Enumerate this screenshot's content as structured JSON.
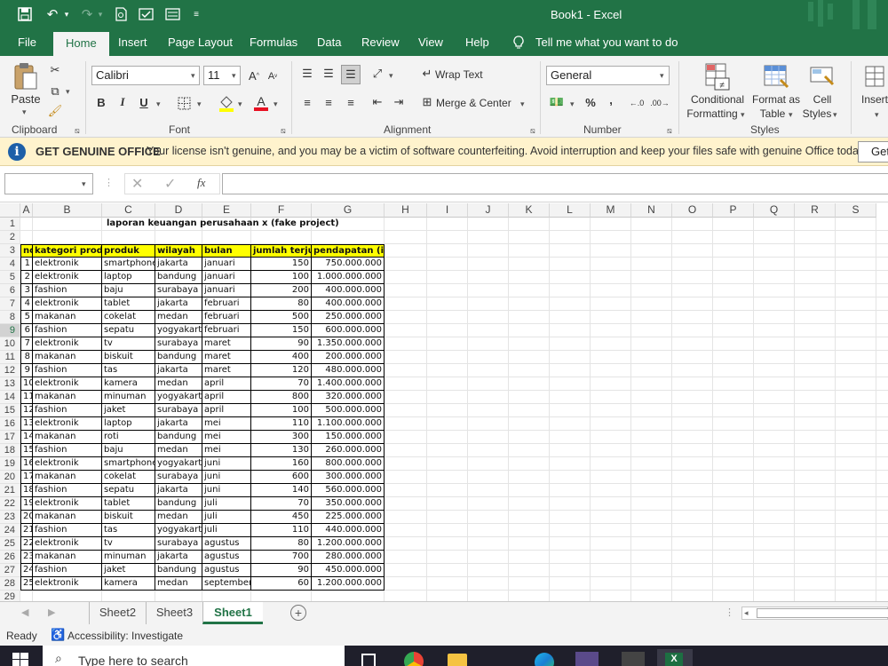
{
  "title_bar": {
    "title": "Book1  -  Excel"
  },
  "tabs": [
    "File",
    "Home",
    "Insert",
    "Page Layout",
    "Formulas",
    "Data",
    "Review",
    "View",
    "Help"
  ],
  "tell_me": "Tell me what you want to do",
  "ribbon": {
    "paste": "Paste",
    "clipboard": "Clipboard",
    "font_name": "Calibri",
    "font_size": "11",
    "font": "Font",
    "bold": "B",
    "italic": "I",
    "underline": "U",
    "wrap_text": "Wrap Text",
    "merge_center": "Merge & Center",
    "alignment": "Alignment",
    "number_format": "General",
    "number": "Number",
    "percent": "%",
    "comma": ",",
    "conditional_formatting_1": "Conditional",
    "conditional_formatting_2": "Formatting",
    "format_as_table_1": "Format as",
    "format_as_table_2": "Table",
    "cell_styles_1": "Cell",
    "cell_styles_2": "Styles",
    "styles": "Styles",
    "insert": "Insert"
  },
  "message_bar": {
    "heading": "GET GENUINE OFFICE",
    "text": "Your license isn't genuine, and you may be a victim of software counterfeiting. Avoid interruption and keep your files safe with genuine Office today.",
    "button": "Get"
  },
  "formula_bar": {
    "name_box": "",
    "fx": "fx",
    "formula": ""
  },
  "columns": [
    "A",
    "B",
    "C",
    "D",
    "E",
    "F",
    "G",
    "H",
    "I",
    "J",
    "K",
    "L",
    "M",
    "N",
    "O",
    "P",
    "Q",
    "R",
    "S"
  ],
  "rows": [
    "1",
    "2",
    "3",
    "4",
    "5",
    "6",
    "7",
    "8",
    "9",
    "10",
    "11",
    "12",
    "13",
    "14",
    "15",
    "16",
    "17",
    "18",
    "19",
    "20",
    "21",
    "22",
    "23",
    "24",
    "25",
    "26",
    "27",
    "28",
    "29"
  ],
  "sheet": {
    "title": "laporan keuangan perusahaan x (fake project)",
    "headers": [
      "no",
      "kategori produk",
      "produk",
      "wilayah",
      "bulan",
      "jumlah terjual",
      "pendapatan (idr)"
    ],
    "data": [
      [
        "1",
        "elektronik",
        "smartphone",
        "jakarta",
        "januari",
        "150",
        "750.000.000"
      ],
      [
        "2",
        "elektronik",
        "laptop",
        "bandung",
        "januari",
        "100",
        "1.000.000.000"
      ],
      [
        "3",
        "fashion",
        "baju",
        "surabaya",
        "januari",
        "200",
        "400.000.000"
      ],
      [
        "4",
        "elektronik",
        "tablet",
        "jakarta",
        "februari",
        "80",
        "400.000.000"
      ],
      [
        "5",
        "makanan",
        "cokelat",
        "medan",
        "februari",
        "500",
        "250.000.000"
      ],
      [
        "6",
        "fashion",
        "sepatu",
        "yogyakarta",
        "februari",
        "150",
        "600.000.000"
      ],
      [
        "7",
        "elektronik",
        "tv",
        "surabaya",
        "maret",
        "90",
        "1.350.000.000"
      ],
      [
        "8",
        "makanan",
        "biskuit",
        "bandung",
        "maret",
        "400",
        "200.000.000"
      ],
      [
        "9",
        "fashion",
        "tas",
        "jakarta",
        "maret",
        "120",
        "480.000.000"
      ],
      [
        "10",
        "elektronik",
        "kamera",
        "medan",
        "april",
        "70",
        "1.400.000.000"
      ],
      [
        "11",
        "makanan",
        "minuman",
        "yogyakarta",
        "april",
        "800",
        "320.000.000"
      ],
      [
        "12",
        "fashion",
        "jaket",
        "surabaya",
        "april",
        "100",
        "500.000.000"
      ],
      [
        "13",
        "elektronik",
        "laptop",
        "jakarta",
        "mei",
        "110",
        "1.100.000.000"
      ],
      [
        "14",
        "makanan",
        "roti",
        "bandung",
        "mei",
        "300",
        "150.000.000"
      ],
      [
        "15",
        "fashion",
        "baju",
        "medan",
        "mei",
        "130",
        "260.000.000"
      ],
      [
        "16",
        "elektronik",
        "smartphone",
        "yogyakarta",
        "juni",
        "160",
        "800.000.000"
      ],
      [
        "17",
        "makanan",
        "cokelat",
        "surabaya",
        "juni",
        "600",
        "300.000.000"
      ],
      [
        "18",
        "fashion",
        "sepatu",
        "jakarta",
        "juni",
        "140",
        "560.000.000"
      ],
      [
        "19",
        "elektronik",
        "tablet",
        "bandung",
        "juli",
        "70",
        "350.000.000"
      ],
      [
        "20",
        "makanan",
        "biskuit",
        "medan",
        "juli",
        "450",
        "225.000.000"
      ],
      [
        "21",
        "fashion",
        "tas",
        "yogyakarta",
        "juli",
        "110",
        "440.000.000"
      ],
      [
        "22",
        "elektronik",
        "tv",
        "surabaya",
        "agustus",
        "80",
        "1.200.000.000"
      ],
      [
        "23",
        "makanan",
        "minuman",
        "jakarta",
        "agustus",
        "700",
        "280.000.000"
      ],
      [
        "24",
        "fashion",
        "jaket",
        "bandung",
        "agustus",
        "90",
        "450.000.000"
      ],
      [
        "25",
        "elektronik",
        "kamera",
        "medan",
        "september",
        "60",
        "1.200.000.000"
      ]
    ]
  },
  "sheet_tabs": [
    "Sheet2",
    "Sheet3",
    "Sheet1"
  ],
  "status": {
    "ready": "Ready",
    "accessibility": "Accessibility: Investigate"
  },
  "taskbar": {
    "search_placeholder": "Type here to search"
  },
  "colors": {
    "excel_green": "#217346",
    "header_yellow": "#ffff00",
    "message_bar": "#fff3cd"
  }
}
